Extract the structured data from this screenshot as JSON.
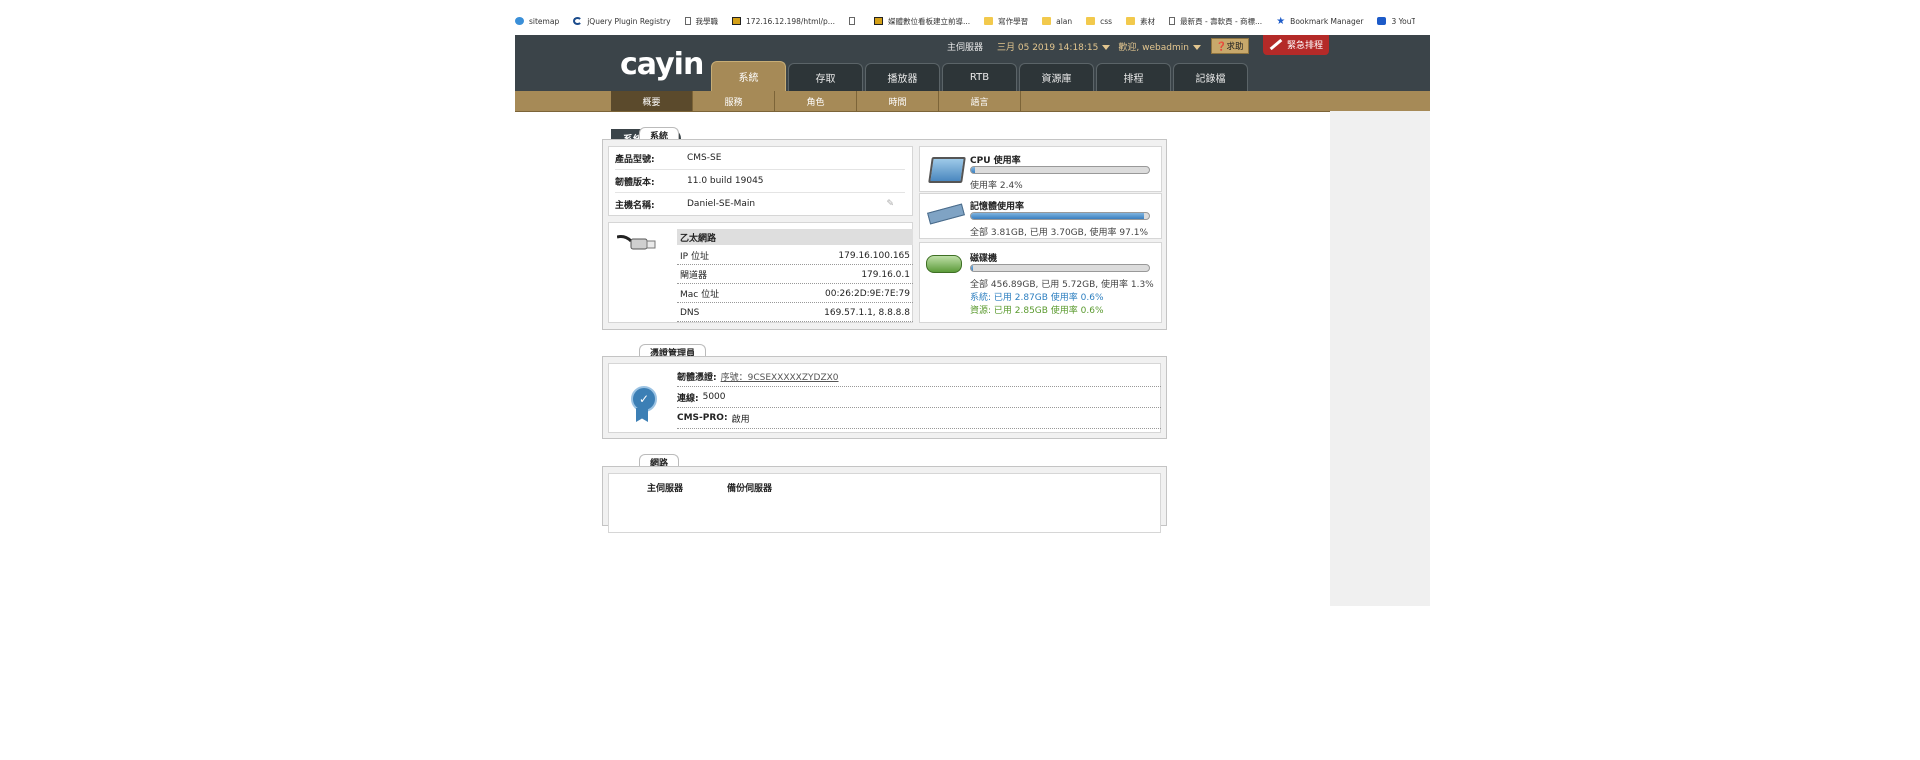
{
  "bookmarks": [
    {
      "label": "sitemap",
      "icon": "globe-icon"
    },
    {
      "label": "jQuery Plugin Registry",
      "icon": "swirl-icon"
    },
    {
      "label": "我學職",
      "icon": "page-icon"
    },
    {
      "label": "172.16.12.198/html/p...",
      "icon": "image-icon"
    },
    {
      "label": "",
      "icon": "page-icon"
    },
    {
      "label": "媒體數位看板建立前導...",
      "icon": "image-icon"
    },
    {
      "label": "寫作學習",
      "icon": "folder-icon"
    },
    {
      "label": "alan",
      "icon": "folder-icon"
    },
    {
      "label": "css",
      "icon": "folder-icon"
    },
    {
      "label": "素材",
      "icon": "folder-icon"
    },
    {
      "label": "最新頁 - 壽軟頁 - 商標...",
      "icon": "page-icon"
    },
    {
      "label": "Bookmark Manager",
      "icon": "star-icon"
    },
    {
      "label": "3 YouTube t",
      "icon": "youtube-icon"
    }
  ],
  "header": {
    "logo": "cayin",
    "server_label": "主伺服器",
    "datetime": "三月 05 2019 14:18:15",
    "welcome": "歡迎, webadmin",
    "help": "求助",
    "urgent": "緊急排程"
  },
  "main_tabs": [
    "系統",
    "存取",
    "播放器",
    "RTB",
    "資源庫",
    "排程",
    "記錄檔"
  ],
  "active_main_tab": 0,
  "sub_tabs": [
    "概要",
    "服務",
    "角色",
    "時間",
    "語言"
  ],
  "active_sub_tab": 0,
  "page_title": "系統概要",
  "system_section": {
    "legend": "系統",
    "product_label": "產品型號:",
    "product_value": "CMS-SE",
    "firmware_label": "韌體版本:",
    "firmware_value": "11.0 build 19045",
    "hostname_label": "主機名稱:",
    "hostname_value": "Daniel-SE-Main",
    "ethernet": {
      "title": "乙太網路",
      "rows": [
        {
          "label": "IP 位址",
          "value": "179.16.100.165"
        },
        {
          "label": "閘道器",
          "value": "179.16.0.1"
        },
        {
          "label": "Mac 位址",
          "value": "00:26:2D:9E:7E:79"
        },
        {
          "label": "DNS",
          "value": "169.57.1.1, 8.8.8.8"
        }
      ]
    },
    "cpu": {
      "title": "CPU 使用率",
      "percent": 2.4,
      "text": "使用率 2.4%"
    },
    "memory": {
      "title": "記憶體使用率",
      "percent": 97.1,
      "text": "全部 3.81GB, 已用 3.70GB, 使用率 97.1%"
    },
    "disk": {
      "title": "磁碟機",
      "percent": 1.3,
      "text": "全部 456.89GB, 已用 5.72GB, 使用率 1.3%",
      "system_text": "系統: 已用 2.87GB 使用率 0.6%",
      "resource_text": "資源: 已用 2.85GB 使用率 0.6%"
    }
  },
  "license_section": {
    "legend": "憑證管理員",
    "firmware_cert_label": "韌體憑證:",
    "firmware_cert_value": "序號：9CSEXXXXXZYDZX0",
    "clients_label": "連線:",
    "clients_value": "5000",
    "cmspro_label": "CMS-PRO:",
    "cmspro_value": "啟用"
  },
  "network_section": {
    "legend": "網路",
    "col_main": "主伺服器",
    "col_backup": "備份伺服器"
  },
  "colors": {
    "header_bg": "#3b4449",
    "accent_gold": "#a68a57",
    "urgent_red": "#b42a28",
    "bar_blue": "#3a7fbf"
  }
}
